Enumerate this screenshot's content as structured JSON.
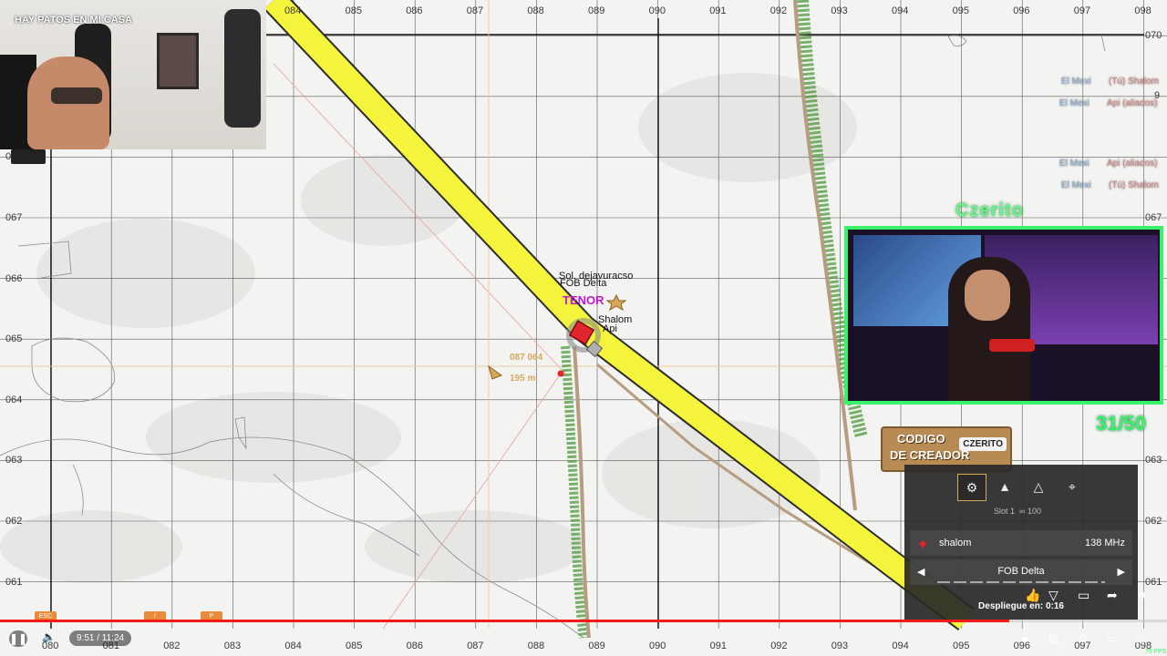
{
  "map": {
    "grid_x_top": [
      "084",
      "085",
      "086",
      "087",
      "088",
      "089",
      "090",
      "091",
      "092",
      "093",
      "094",
      "095",
      "096",
      "097",
      "098"
    ],
    "grid_x_bottom": [
      "080",
      "081",
      "082",
      "083",
      "084",
      "085",
      "086",
      "087",
      "088",
      "089",
      "090",
      "091",
      "092",
      "093",
      "094",
      "095",
      "096",
      "097",
      "098"
    ],
    "grid_y_left": [
      "067",
      "066",
      "065",
      "064",
      "063",
      "062",
      "061"
    ],
    "grid_y_right": [
      "070",
      "067",
      "066",
      "065",
      "064",
      "063",
      "062",
      "061"
    ],
    "partial_y_left": "0",
    "partial_y_right": "9",
    "markers": {
      "fob_delta": "FOB Delta",
      "squad_leader": "Sol. dejavuracso",
      "tenor": "TENOR",
      "shalom": "Shalom",
      "api": "Api",
      "cursor_coords": "087 064",
      "cursor_distance": "195 m"
    }
  },
  "webcam_left": {
    "title": "HAY PATOS EN MI CASA"
  },
  "streamer": {
    "name": "Czerito",
    "sub_goal": "31/50"
  },
  "creator_code": {
    "line1": "CODIGO",
    "line2": "DE CREADOR",
    "logo": "CZERITO"
  },
  "squad_list": [
    {
      "name": "El Mexi",
      "role": "(Tú) Shalom"
    },
    {
      "name": "El Mexi",
      "role": "Api (aliados)"
    },
    {
      "name": "El Mexi",
      "role": "Api (aliados)"
    },
    {
      "name": "El Mexi",
      "role": "(Tú) Shalom"
    }
  ],
  "deploy_panel": {
    "slot": "Slot 1",
    "ammo": "100",
    "player": "shalom",
    "frequency": "138 MHz",
    "spawn": "FOB Delta",
    "deploy_label": "Despliegue en:",
    "deploy_time": "0:16"
  },
  "hotkeys": [
    "ESC",
    "/",
    "P"
  ],
  "player": {
    "time": "9:51 / 11:24",
    "progress": 0.865,
    "fps": "75 FPS"
  },
  "colors": {
    "road": "#f4f43c",
    "road_edge": "#2c2c2c",
    "trail": "#b69c80",
    "trees": "#4d9a3a",
    "grid": "#1a1a1a",
    "accent_green": "#3af26a",
    "progress": "#ff1a1a",
    "fob_red": "#e0252c",
    "tenor_magenta": "#c31ad0"
  }
}
